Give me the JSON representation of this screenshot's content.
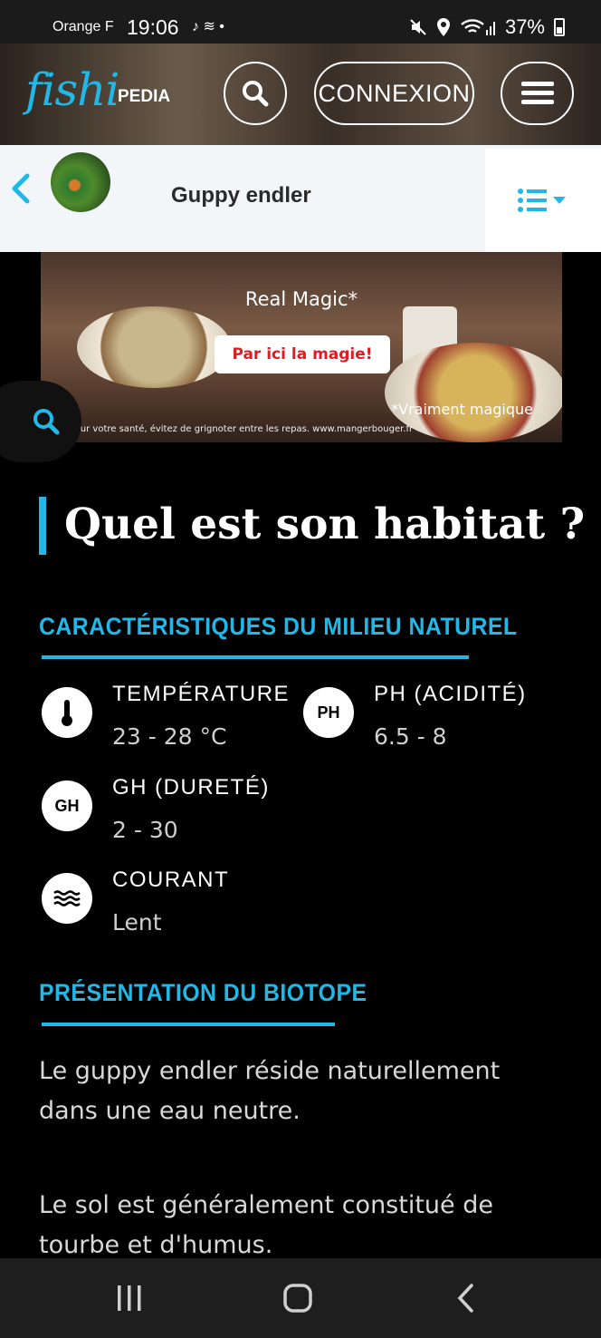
{
  "status_bar": {
    "carrier": "Orange F",
    "time": "19:06",
    "battery": "37%"
  },
  "header": {
    "logo_main": "fishi",
    "logo_sub": "PEDIA",
    "login_label": "CONNEXION",
    "brand_color": "#1fb8e8"
  },
  "species_bar": {
    "name": "Guppy endler"
  },
  "ad": {
    "tagline": "Real Magic*",
    "cta": "Par ici la magie!",
    "note": "*Vraiment magique",
    "legal": "Pour votre santé, évitez de grignoter entre les repas. www.mangerbouger.fr"
  },
  "content": {
    "section_title": "Quel est son habitat ?",
    "milieu_heading": "CARACTÉRISTIQUES DU MILIEU NATUREL",
    "params": [
      {
        "icon": "thermometer-icon",
        "icon_text": "",
        "label": "TEMPÉRATURE",
        "value": "23 - 28 °C"
      },
      {
        "icon": "ph-icon",
        "icon_text": "PH",
        "label": "PH (ACIDITÉ)",
        "value": "6.5 - 8"
      },
      {
        "icon": "gh-icon",
        "icon_text": "GH",
        "label": "GH (DURETÉ)",
        "value": "2 - 30"
      },
      {
        "icon": "waves-icon",
        "icon_text": "",
        "label": "COURANT",
        "value": "Lent"
      }
    ],
    "biotope_heading": "PRÉSENTATION DU BIOTOPE",
    "paragraphs": [
      "Le guppy endler réside naturellement dans une eau neutre.",
      "Le sol est généralement constitué de tourbe et d'humus."
    ]
  }
}
